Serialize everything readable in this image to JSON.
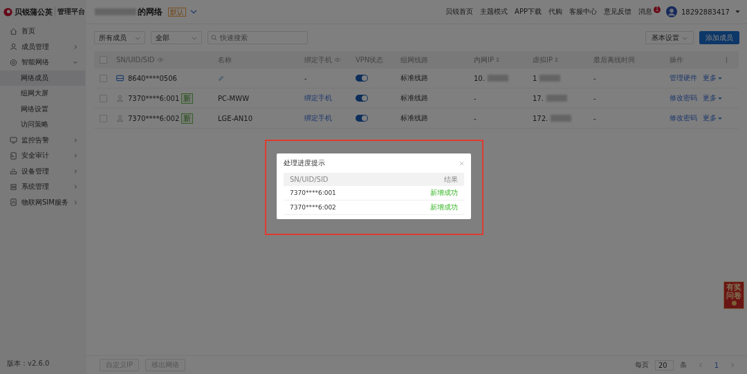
{
  "header": {
    "brand": "贝锐蒲公英",
    "platform": "管理平台",
    "network_suffix": "的网络",
    "network_badge": "默认",
    "nav": [
      "贝锐首页",
      "主题模式",
      "APP下载",
      "代购",
      "客服中心",
      "意见反馈"
    ],
    "messages": {
      "label": "消息",
      "count": "1"
    },
    "user": "18292883417"
  },
  "sidebar": {
    "items": [
      {
        "label": "首页",
        "kind": "link"
      },
      {
        "label": "成员管理",
        "kind": "group",
        "expanded": false
      },
      {
        "label": "智能网络",
        "kind": "group",
        "expanded": true,
        "children": [
          {
            "label": "网络成员",
            "selected": true
          },
          {
            "label": "组网大屏",
            "selected": false
          },
          {
            "label": "网络设置",
            "selected": false
          },
          {
            "label": "访问策略",
            "selected": false
          }
        ]
      },
      {
        "label": "监控告警",
        "kind": "group",
        "expanded": false
      },
      {
        "label": "安全审计",
        "kind": "group",
        "expanded": false
      },
      {
        "label": "设备管理",
        "kind": "group",
        "expanded": false
      },
      {
        "label": "系统管理",
        "kind": "group",
        "expanded": false
      },
      {
        "label": "物联网SIM服务",
        "kind": "group",
        "expanded": false
      }
    ],
    "version": "版本：v2.6.0"
  },
  "toolbar": {
    "filters": [
      "所有成员",
      "全部"
    ],
    "search": {
      "placeholder": "快速搜索"
    },
    "buttons": [
      {
        "label": "基本设置",
        "kind": "dropdown"
      },
      {
        "label": "添加成员",
        "kind": "primary"
      }
    ]
  },
  "table": {
    "all_checked": false,
    "columns": [
      {
        "label": "SN/UID/SID",
        "kind": "masked"
      },
      {
        "label": "名称",
        "kind": "plain"
      },
      {
        "label": "绑定手机",
        "kind": "masked"
      },
      {
        "label": "VPN状态",
        "kind": "plain"
      },
      {
        "label": "组网线路",
        "kind": "plain"
      },
      {
        "label": "内网IP",
        "kind": "sortable"
      },
      {
        "label": "虚拟IP",
        "kind": "sortable"
      },
      {
        "label": "最后离线时间",
        "kind": "plain"
      },
      {
        "label": "操作",
        "kind": "plain"
      }
    ],
    "rows": [
      {
        "kind": "device",
        "checked": false,
        "sn": "8640****0506",
        "phone": {
          "text": "-",
          "kind": "text"
        },
        "vpn_on": true,
        "route": "标准线路",
        "lan_ip": "10.",
        "virtual_ip": "1",
        "last_offline": "-",
        "actions": [
          "管理硬件",
          "更多"
        ]
      },
      {
        "kind": "user",
        "checked": false,
        "sn": "7370****6:001",
        "badge": "新",
        "name": "PC-MWW",
        "phone": {
          "text": "绑定手机",
          "kind": "link"
        },
        "vpn_on": true,
        "route": "标准线路",
        "lan_ip": "-",
        "virtual_ip": "17.",
        "last_offline": "-",
        "actions": [
          "修改密码",
          "更多"
        ]
      },
      {
        "kind": "user",
        "checked": false,
        "sn": "7370****6:002",
        "badge": "新",
        "name": "LGE-AN10",
        "phone": {
          "text": "绑定手机",
          "kind": "link"
        },
        "vpn_on": true,
        "route": "标准线路",
        "lan_ip": "-",
        "virtual_ip": "172.",
        "last_offline": "-",
        "actions": [
          "修改密码",
          "更多"
        ]
      }
    ]
  },
  "footer": {
    "buttons": [
      {
        "label": "自定义IP",
        "disabled": true
      },
      {
        "label": "移出网络",
        "disabled": true
      }
    ],
    "pagination": {
      "per_page_label": "每页",
      "page_size": "20",
      "unit": "条",
      "page": "1"
    }
  },
  "promo": {
    "text": "有奖问卷"
  },
  "dialog": {
    "title": "处理进度提示",
    "columns": [
      "SN/UID/SID",
      "结果"
    ],
    "rows": [
      {
        "sn": "7370****6:001",
        "result": "新增成功"
      },
      {
        "sn": "7370****6:002",
        "result": "新增成功"
      }
    ]
  }
}
